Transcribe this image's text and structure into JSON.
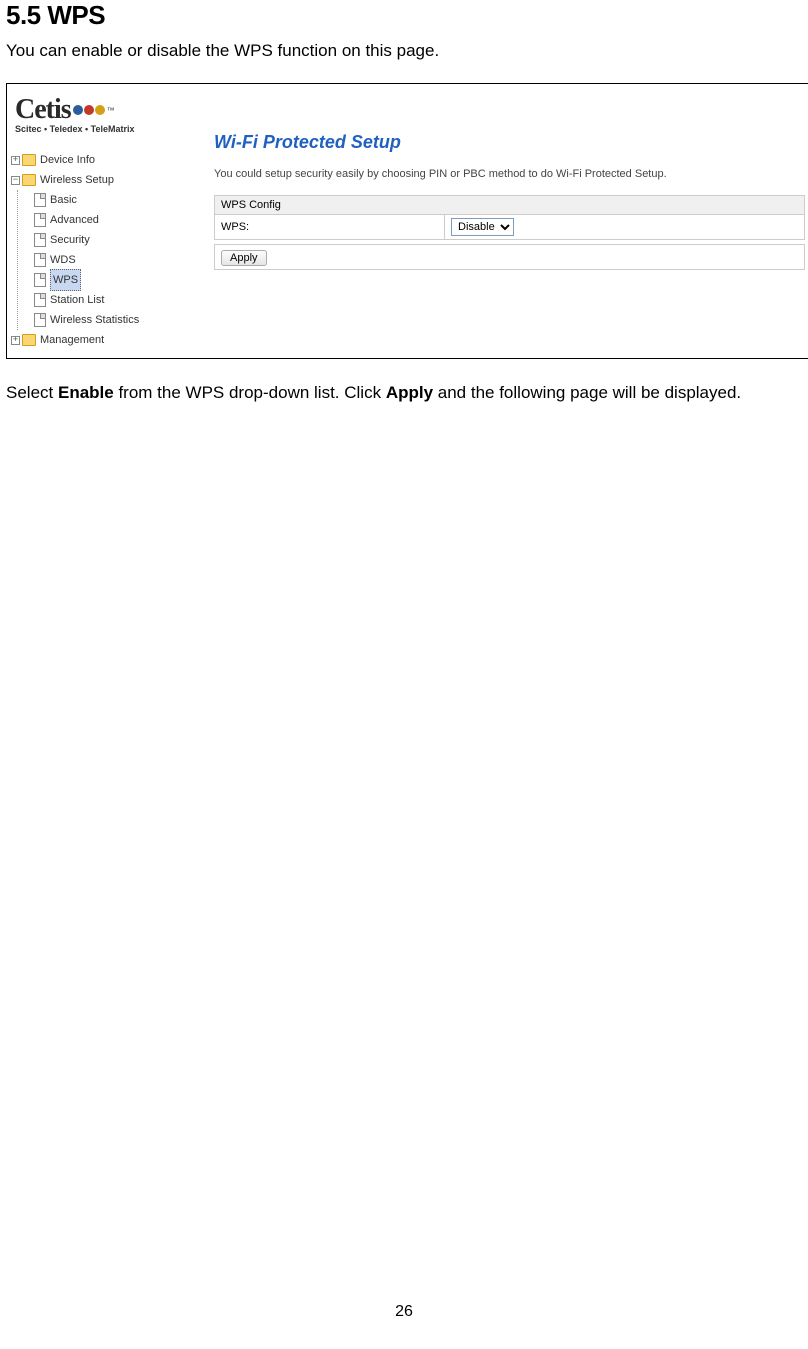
{
  "heading": "5.5  WPS",
  "intro": "You can enable or disable the WPS function on this page.",
  "logo": {
    "main": "Cetis",
    "sub": "Scitec • Teledex • TeleMatrix",
    "tm": "™"
  },
  "tree": {
    "device_info": "Device Info",
    "wireless_setup": "Wireless Setup",
    "basic": "Basic",
    "advanced": "Advanced",
    "security": "Security",
    "wds": "WDS",
    "wps": "WPS",
    "station_list": "Station List",
    "wireless_statistics": "Wireless Statistics",
    "management": "Management",
    "plus": "+",
    "minus": "−"
  },
  "panel": {
    "title": "Wi-Fi Protected Setup",
    "desc": "You could setup security easily by choosing PIN or PBC method to do Wi-Fi Protected Setup.",
    "config_header": "WPS Config",
    "wps_label": "WPS:",
    "wps_value": "Disable",
    "apply": "Apply"
  },
  "post_text_1": "Select ",
  "post_text_enable": "Enable",
  "post_text_2": " from the WPS drop-down list. Click ",
  "post_text_apply": "Apply",
  "post_text_3": " and the following page will be displayed.",
  "page_number": "26"
}
